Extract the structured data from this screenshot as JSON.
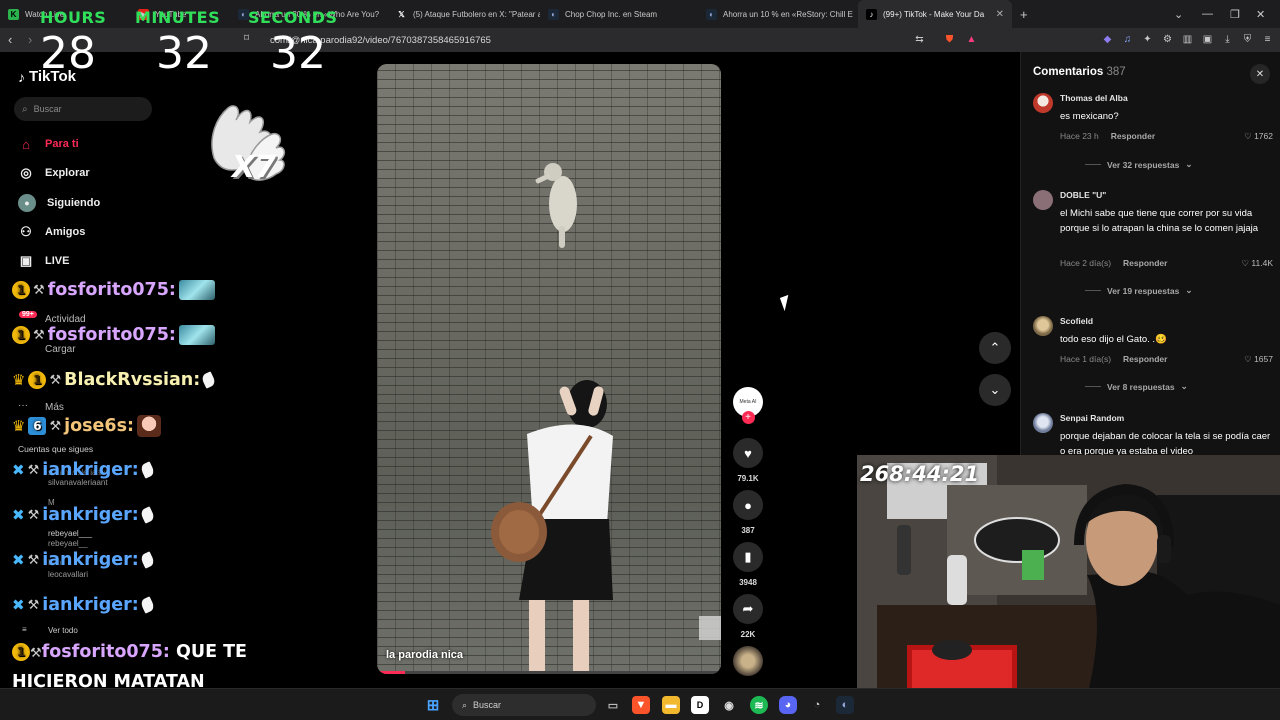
{
  "browser": {
    "tabs": [
      {
        "label": "",
        "favicon": "green",
        "active": false
      },
      {
        "label": "Watch Live",
        "favicon": "",
        "active": false
      },
      {
        "label": "YouTube",
        "favicon": "red",
        "active": false
      },
      {
        "label": "Ahorra un 30 % en «Who Are You?",
        "favicon": "steam",
        "active": false
      },
      {
        "label": "(5) Ataque Futbolero en X: \"Patear a",
        "favicon": "x",
        "active": false
      },
      {
        "label": "Chop Chop Inc. en Steam",
        "favicon": "steam",
        "active": false
      },
      {
        "label": "Ahorra un 10 % en «ReStory: Chill E",
        "favicon": "steam",
        "active": false
      },
      {
        "label": "(99+) TikTok - Make Your Da",
        "favicon": "tiktok",
        "active": true
      }
    ],
    "url": "com/@nica.parodia92/video/7670387358465916765"
  },
  "timer": {
    "hours_label": "HOURS",
    "minutes_label": "MINUTES",
    "seconds_label": "SECONDS",
    "hours": "28",
    "minutes": "32",
    "seconds": "32"
  },
  "sidebar": {
    "logo": "TikTok",
    "search_placeholder": "Buscar",
    "nav": [
      {
        "label": "Para ti",
        "icon": "home-icon"
      },
      {
        "label": "Explorar",
        "icon": "compass-icon"
      },
      {
        "label": "Siguiendo",
        "icon": "following-icon"
      },
      {
        "label": "Amigos",
        "icon": "friends-icon"
      },
      {
        "label": "LIVE",
        "icon": "live-icon"
      }
    ],
    "activity_badge": "99+",
    "activity": "Actividad",
    "upload": "Cargar",
    "more": "Más",
    "following_heading": "Cuentas que sigues",
    "following": [
      {
        "name": "silvanavaleriaant",
        "handle": "silvanavaleriaant"
      },
      {
        "name": "M",
        "handle": "rebeyael___"
      },
      {
        "name": "rebeyael___",
        "handle": "rebeyael__"
      },
      {
        "name": "Leo",
        "handle": "leocavallari"
      }
    ],
    "see_all": "Ver todo"
  },
  "chat": {
    "emote_label": "X7",
    "lines": [
      {
        "user": "fosforito075:",
        "badge": "1"
      },
      {
        "user": "fosforito075:",
        "badge": "1"
      },
      {
        "user": "BlackRvssian:",
        "badge": "1"
      },
      {
        "user": "jose6s:",
        "badge": "6"
      },
      {
        "user": "iankriger:",
        "badge": ""
      },
      {
        "user": "iankriger:",
        "badge": ""
      },
      {
        "user": "iankriger:",
        "badge": ""
      },
      {
        "user": "iankriger:",
        "badge": ""
      }
    ],
    "final_user": "fosforito075:",
    "final_message": "QUE TE HICIERON MATATAN",
    "final_badge": "1"
  },
  "video": {
    "author": "la parodia nica",
    "progress": 0.08,
    "meta_ai": "Meta AI",
    "likes": "79.1K",
    "comments": "387",
    "saves": "3948",
    "shares": "22K"
  },
  "comments_panel": {
    "title": "Comentarios",
    "count": "387",
    "items": [
      {
        "user": "Thomas del Alba",
        "text": "es mexicano?",
        "time": "Hace 23 h",
        "reply": "Responder",
        "likes": "1762",
        "replies": "Ver 32 respuestas",
        "avatar_color": "#c0392b"
      },
      {
        "user": "DOBLE \"U\"",
        "text": "el Michi sabe que tiene que correr por su vida porque si lo atrapan la china se lo comen jajaja",
        "time": "Hace 2 día(s)",
        "reply": "Responder",
        "likes": "11.4K",
        "replies": "Ver 19 respuestas",
        "avatar_color": "#8a6f77"
      },
      {
        "user": "Scofield",
        "text": "todo eso dijo el Gato. .🥴",
        "time": "Hace 1 día(s)",
        "reply": "Responder",
        "likes": "1657",
        "replies": "Ver 8 respuestas",
        "avatar_color": "#b8a27a"
      },
      {
        "user": "Senpai Random",
        "text": "porque dejaban de colocar la tela si se podía caer o era porque ya estaba el video",
        "time": "",
        "reply": "",
        "likes": "",
        "replies": "",
        "avatar_color": "#6f7d9b"
      }
    ]
  },
  "webcam": {
    "stream_time": "268:44:21"
  },
  "taskbar": {
    "search_placeholder": "Buscar"
  }
}
